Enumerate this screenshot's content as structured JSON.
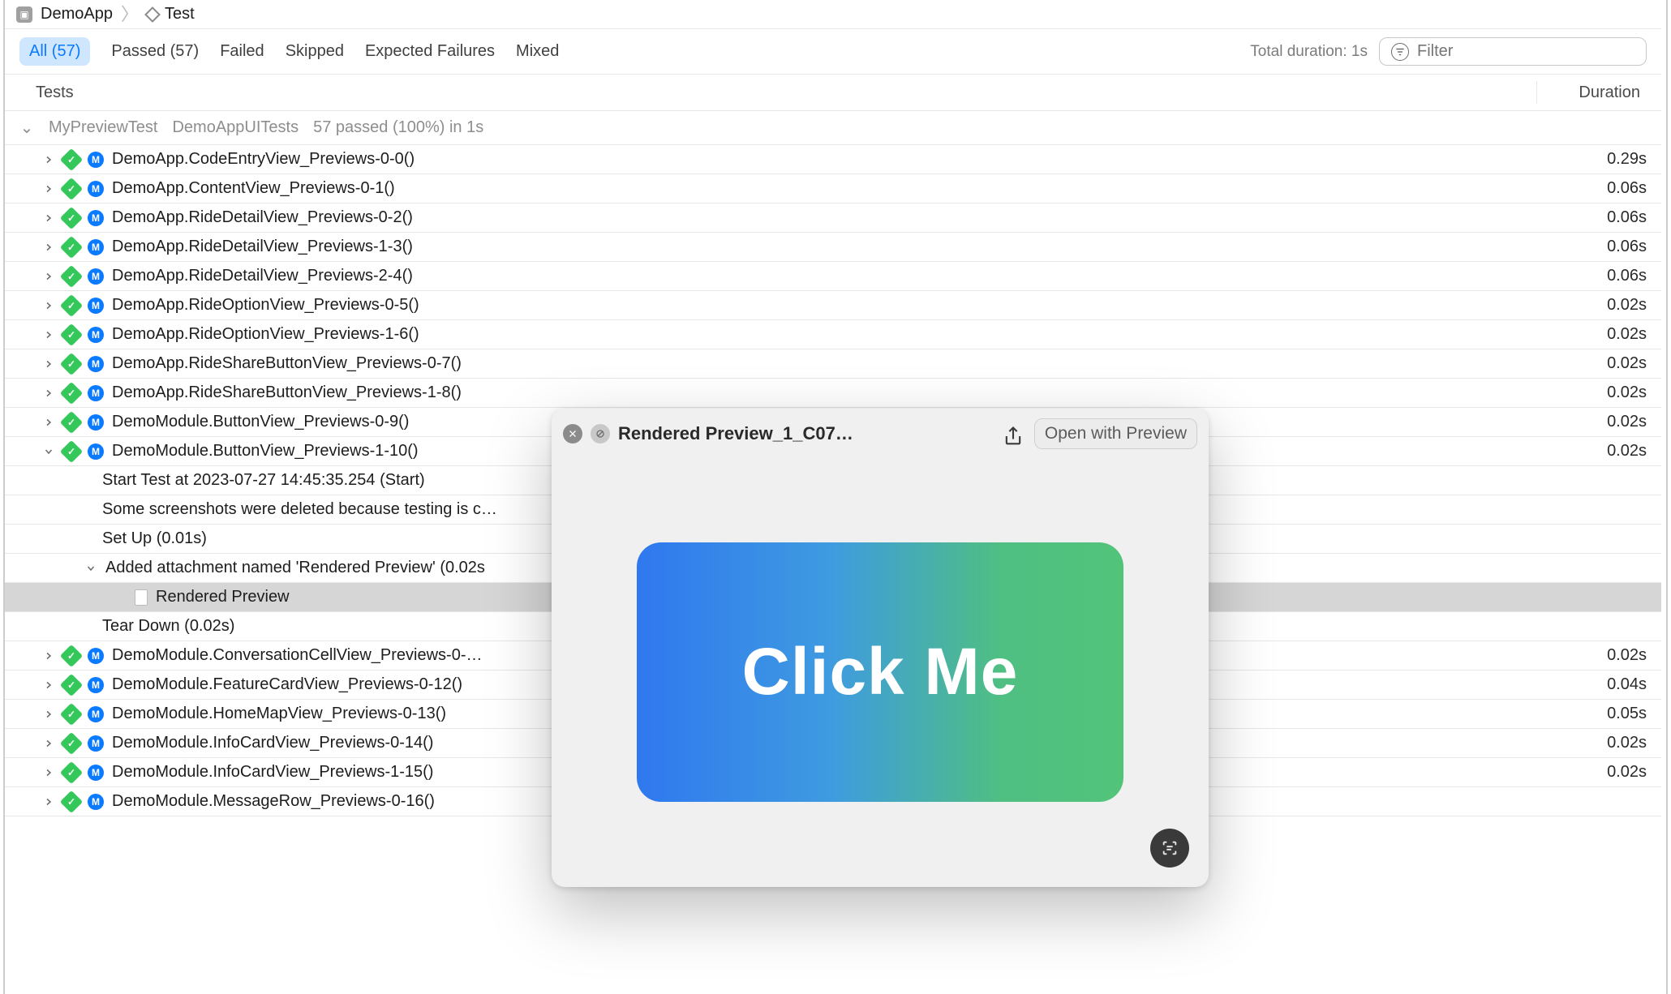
{
  "breadcrumb": {
    "app": "DemoApp",
    "target": "Test"
  },
  "tabs": {
    "all": "All (57)",
    "passed": "Passed (57)",
    "failed": "Failed",
    "skipped": "Skipped",
    "expected_failures": "Expected Failures",
    "mixed": "Mixed"
  },
  "total_duration": "Total duration: 1s",
  "filter_placeholder": "Filter",
  "columns": {
    "tests": "Tests",
    "duration": "Duration"
  },
  "group": {
    "scheme": "MyPreviewTest",
    "bundle": "DemoAppUITests",
    "summary": "57 passed (100%) in 1s"
  },
  "rows": [
    {
      "name": "DemoApp.CodeEntryView_Previews-0-0()",
      "dur": "0.29s"
    },
    {
      "name": "DemoApp.ContentView_Previews-0-1()",
      "dur": "0.06s"
    },
    {
      "name": "DemoApp.RideDetailView_Previews-0-2()",
      "dur": "0.06s"
    },
    {
      "name": "DemoApp.RideDetailView_Previews-1-3()",
      "dur": "0.06s"
    },
    {
      "name": "DemoApp.RideDetailView_Previews-2-4()",
      "dur": "0.06s"
    },
    {
      "name": "DemoApp.RideOptionView_Previews-0-5()",
      "dur": "0.02s"
    },
    {
      "name": "DemoApp.RideOptionView_Previews-1-6()",
      "dur": "0.02s"
    },
    {
      "name": "DemoApp.RideShareButtonView_Previews-0-7()",
      "dur": "0.02s"
    },
    {
      "name": "DemoApp.RideShareButtonView_Previews-1-8()",
      "dur": "0.02s"
    },
    {
      "name": "DemoModule.ButtonView_Previews-0-9()",
      "dur": "0.02s"
    },
    {
      "name": "DemoModule.ButtonView_Previews-1-10()",
      "dur": "0.02s",
      "expanded": true,
      "details": [
        "Start Test at 2023-07-27 14:45:35.254 (Start)",
        "Some screenshots were deleted because testing is c…",
        "Set Up (0.01s)"
      ],
      "attachment_line": "Added attachment named 'Rendered Preview' (0.02s",
      "attachment_name": "Rendered Preview",
      "teardown": "Tear Down (0.02s)"
    },
    {
      "name": "DemoModule.ConversationCellView_Previews-0-…",
      "dur": "0.02s"
    },
    {
      "name": "DemoModule.FeatureCardView_Previews-0-12()",
      "dur": "0.04s"
    },
    {
      "name": "DemoModule.HomeMapView_Previews-0-13()",
      "dur": "0.05s"
    },
    {
      "name": "DemoModule.InfoCardView_Previews-0-14()",
      "dur": "0.02s"
    },
    {
      "name": "DemoModule.InfoCardView_Previews-1-15()",
      "dur": "0.02s"
    },
    {
      "name": "DemoModule.MessageRow_Previews-0-16()",
      "dur": ""
    }
  ],
  "popover": {
    "title": "Rendered Preview_1_C07…",
    "open_label": "Open with Preview",
    "button_label": "Click Me"
  }
}
